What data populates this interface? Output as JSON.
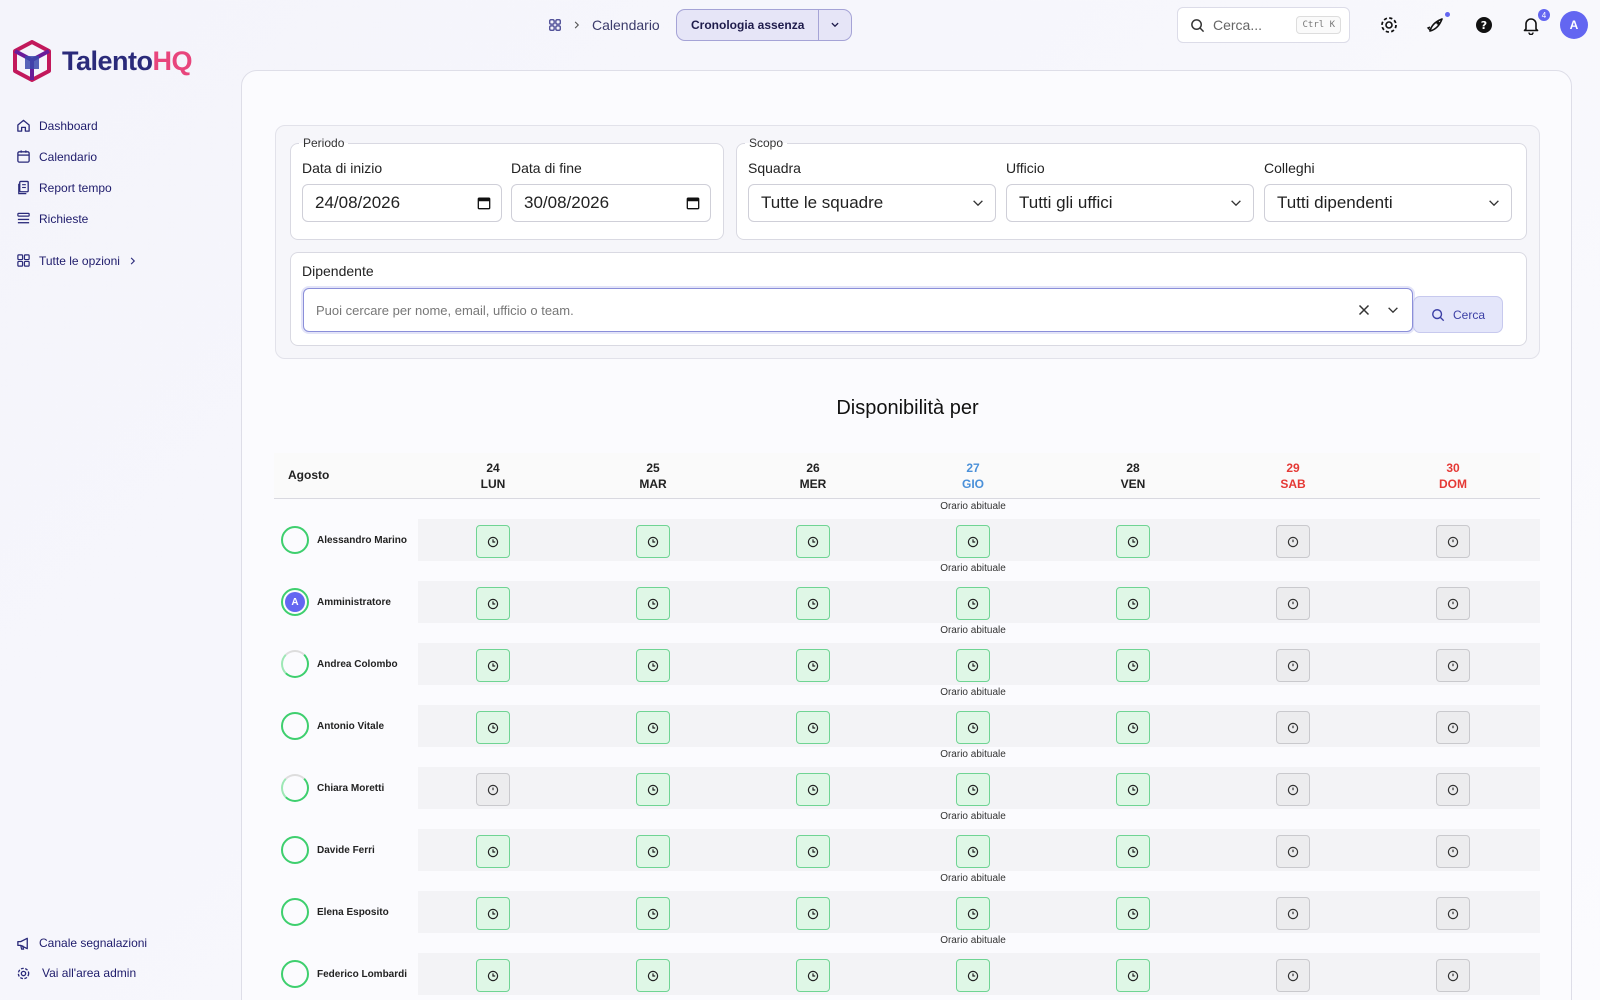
{
  "brand": {
    "name_part1": "Talento",
    "name_part2": "HQ"
  },
  "sidebar": {
    "items": [
      {
        "label": "Dashboard",
        "icon": "home-icon"
      },
      {
        "label": "Calendario",
        "icon": "calendar-icon"
      },
      {
        "label": "Report tempo",
        "icon": "report-icon"
      },
      {
        "label": "Richieste",
        "icon": "list-icon"
      }
    ],
    "more_label": "Tutte le opzioni",
    "bottom": [
      {
        "label": "Canale segnalazioni",
        "icon": "megaphone-icon"
      },
      {
        "label": "Vai all'area admin",
        "icon": "gear-icon"
      }
    ]
  },
  "topbar": {
    "breadcrumb": "Calendario",
    "view_button": "Cronologia assenza",
    "search_placeholder": "Cerca...",
    "search_shortcut": "Ctrl K",
    "notifications_count": "4",
    "user_initial": "A"
  },
  "filters": {
    "period_legend": "Periodo",
    "start_label": "Data di inizio",
    "start_value": "24/08/2026",
    "end_label": "Data di fine",
    "end_value": "30/08/2026",
    "scope_legend": "Scopo",
    "team_label": "Squadra",
    "team_value": "Tutte le squadre",
    "office_label": "Ufficio",
    "office_value": "Tutti gli uffici",
    "colleagues_label": "Colleghi",
    "colleagues_value": "Tutti dipendenti",
    "employee_label": "Dipendente",
    "employee_placeholder": "Puoi cercare per nome, email, ufficio o team.",
    "search_button": "Cerca"
  },
  "availability": {
    "title": "Disponibilità per",
    "month": "Agosto",
    "note": "Orario abituale",
    "colors": {
      "today": "#4a90d9",
      "weekend": "#e53935",
      "work": "#dff7e6",
      "off": "#ececee"
    },
    "days": [
      {
        "num": "24",
        "dow": "LUN",
        "kind": "normal"
      },
      {
        "num": "25",
        "dow": "MAR",
        "kind": "normal"
      },
      {
        "num": "26",
        "dow": "MER",
        "kind": "normal"
      },
      {
        "num": "27",
        "dow": "GIO",
        "kind": "today"
      },
      {
        "num": "28",
        "dow": "VEN",
        "kind": "normal"
      },
      {
        "num": "29",
        "dow": "SAB",
        "kind": "weekend"
      },
      {
        "num": "30",
        "dow": "DOM",
        "kind": "weekend"
      }
    ],
    "employees": [
      {
        "name": "Alessandro Marino",
        "avatar": "ring",
        "cells": [
          "work",
          "work",
          "work",
          "work",
          "work",
          "off",
          "off"
        ]
      },
      {
        "name": "Amministratore",
        "avatar": "admin",
        "initial": "A",
        "cells": [
          "work",
          "work",
          "work",
          "work",
          "work",
          "off",
          "off"
        ]
      },
      {
        "name": "Andrea Colombo",
        "avatar": "ring-partial",
        "cells": [
          "work",
          "work",
          "work",
          "work",
          "work",
          "off",
          "off"
        ]
      },
      {
        "name": "Antonio Vitale",
        "avatar": "ring",
        "cells": [
          "work",
          "work",
          "work",
          "work",
          "work",
          "off",
          "off"
        ]
      },
      {
        "name": "Chiara Moretti",
        "avatar": "ring-partial",
        "cells": [
          "off",
          "work",
          "work",
          "work",
          "work",
          "off",
          "off"
        ]
      },
      {
        "name": "Davide Ferri",
        "avatar": "ring",
        "cells": [
          "work",
          "work",
          "work",
          "work",
          "work",
          "off",
          "off"
        ]
      },
      {
        "name": "Elena Esposito",
        "avatar": "ring",
        "cells": [
          "work",
          "work",
          "work",
          "work",
          "work",
          "off",
          "off"
        ]
      },
      {
        "name": "Federico Lombardi",
        "avatar": "ring",
        "cells": [
          "work",
          "work",
          "work",
          "work",
          "work",
          "off",
          "off"
        ]
      }
    ]
  }
}
